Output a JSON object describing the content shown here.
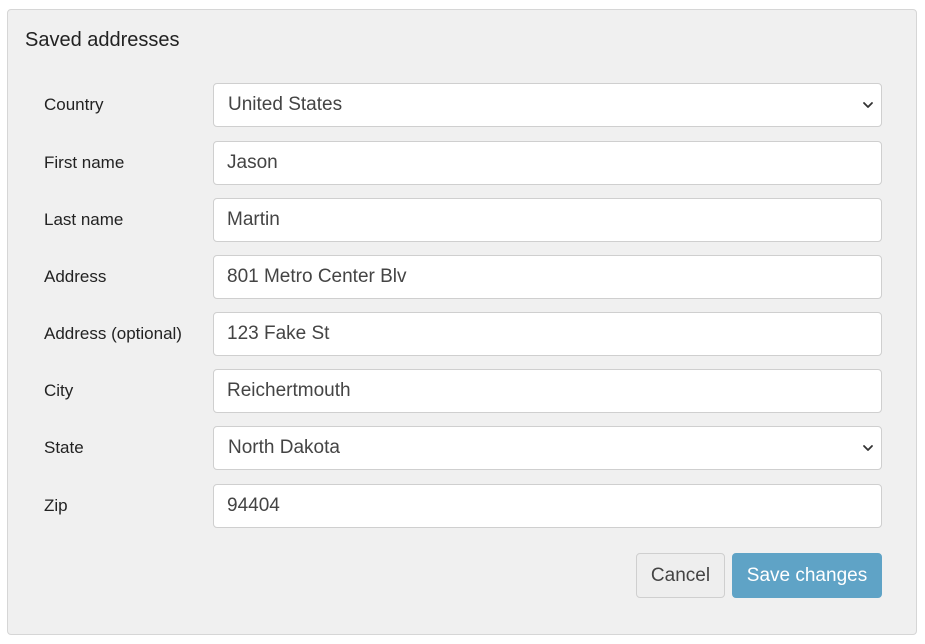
{
  "panel": {
    "title": "Saved addresses"
  },
  "form": {
    "country": {
      "label": "Country",
      "value": "United States"
    },
    "first_name": {
      "label": "First name",
      "value": "Jason"
    },
    "last_name": {
      "label": "Last name",
      "value": "Martin"
    },
    "address": {
      "label": "Address",
      "value": "801 Metro Center Blv"
    },
    "address2": {
      "label": "Address (optional)",
      "value": "123 Fake St"
    },
    "city": {
      "label": "City",
      "value": "Reichertmouth"
    },
    "state": {
      "label": "State",
      "value": "North Dakota"
    },
    "zip": {
      "label": "Zip",
      "value": "94404"
    }
  },
  "actions": {
    "cancel_label": "Cancel",
    "save_label": "Save changes"
  },
  "colors": {
    "panel_bg": "#f0f0f0",
    "primary_button": "#5fa3c6",
    "input_border": "#cfcfcf"
  },
  "icons": {
    "select_indicator": "chevron-down-icon"
  }
}
